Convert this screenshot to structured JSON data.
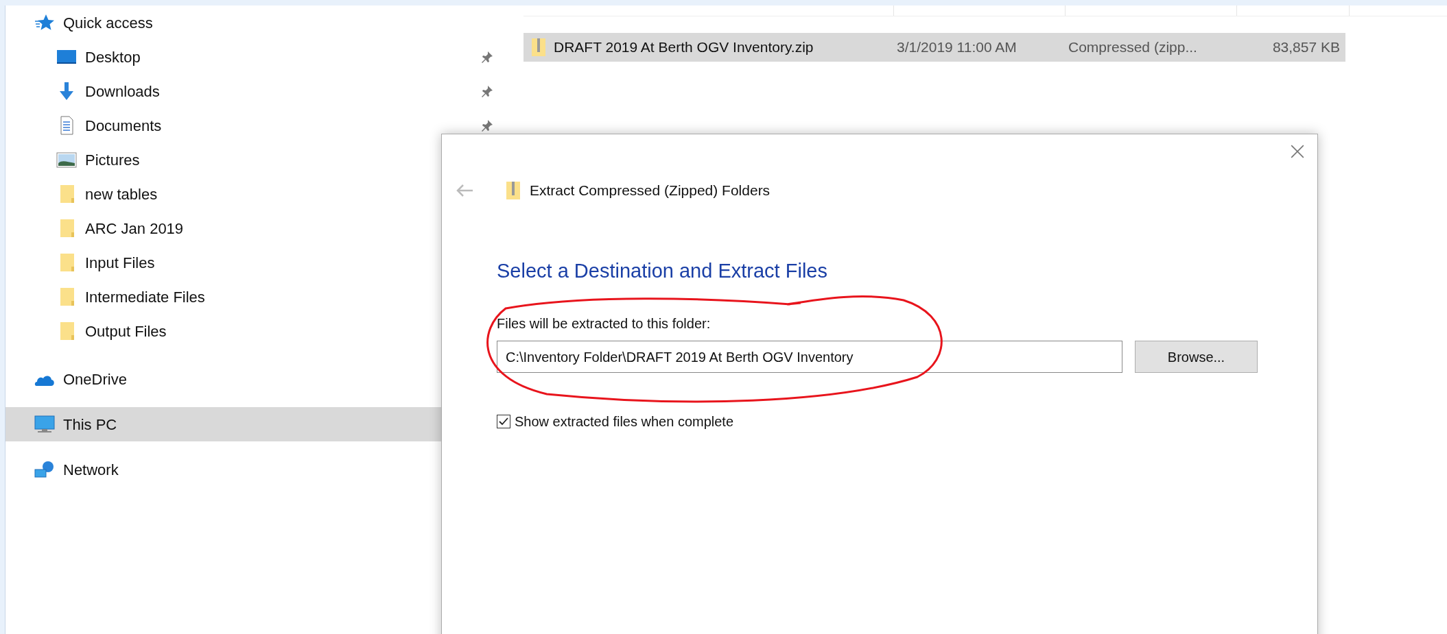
{
  "sidebar": {
    "items": [
      {
        "label": "Quick access",
        "kind": "quick-access",
        "selected": false,
        "children": [
          {
            "label": "Desktop",
            "kind": "desktop",
            "pinned": true,
            "selected": false
          },
          {
            "label": "Downloads",
            "kind": "downloads",
            "pinned": true,
            "selected": false
          },
          {
            "label": "Documents",
            "kind": "documents",
            "pinned": true,
            "selected": false
          },
          {
            "label": "Pictures",
            "kind": "pictures",
            "selected": false
          },
          {
            "label": "new tables",
            "kind": "folder",
            "selected": false
          },
          {
            "label": "ARC Jan 2019",
            "kind": "folder",
            "selected": false
          },
          {
            "label": "Input Files",
            "kind": "folder",
            "selected": false
          },
          {
            "label": "Intermediate Files",
            "kind": "folder",
            "selected": false
          },
          {
            "label": "Output Files",
            "kind": "folder",
            "selected": false
          }
        ]
      },
      {
        "label": "OneDrive",
        "kind": "onedrive",
        "selected": false
      },
      {
        "label": "This PC",
        "kind": "pc",
        "selected": true
      },
      {
        "label": "Network",
        "kind": "network",
        "selected": false
      }
    ]
  },
  "file_list": {
    "rows": [
      {
        "name": "DRAFT 2019 At Berth OGV Inventory.zip",
        "date": "3/1/2019 11:00 AM",
        "type": "Compressed (zipp...",
        "size": "83,857 KB",
        "selected": true
      }
    ]
  },
  "dialog": {
    "title": "Extract Compressed (Zipped) Folders",
    "heading": "Select a Destination and Extract Files",
    "field_label": "Files will be extracted to this folder:",
    "path": "C:\\Inventory Folder\\DRAFT 2019 At Berth OGV Inventory",
    "browse_button": "Browse...",
    "show_files": {
      "label": "Show extracted files when complete",
      "checked": true
    }
  }
}
